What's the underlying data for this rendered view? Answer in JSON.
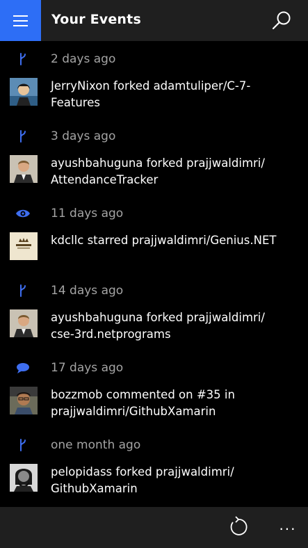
{
  "header": {
    "title": "Your Events",
    "menu_icon": "hamburger-menu-icon",
    "search_icon": "search-icon",
    "accent": "#2d6ef6"
  },
  "events": [
    {
      "type": "fork",
      "icon": "fork-icon",
      "time": "2 days ago",
      "user": "JerryNixon",
      "description": "JerryNixon forked adamtuliper/C-7-Features",
      "line1": "JerryNixon forked adamtuliper/C-7-",
      "line2": "Features"
    },
    {
      "type": "fork",
      "icon": "fork-icon",
      "time": "3 days ago",
      "user": "ayushbahuguna",
      "description": "ayushbahuguna forked prajjwaldimri/AttendanceTracker",
      "line1": "ayushbahuguna forked prajjwaldimri/",
      "line2": "AttendanceTracker"
    },
    {
      "type": "star",
      "icon": "eye-icon",
      "time": "11 days ago",
      "user": "kdcllc",
      "description": "kdcllc starred prajjwaldimri/Genius.NET",
      "line1": "kdcllc starred prajjwaldimri/Genius.NET",
      "line2": ""
    },
    {
      "type": "fork",
      "icon": "fork-icon",
      "time": "14 days ago",
      "user": "ayushbahuguna",
      "description": "ayushbahuguna forked prajjwaldimri/cse-3rd.netprograms",
      "line1": "ayushbahuguna forked prajjwaldimri/",
      "line2": "cse-3rd.netprograms"
    },
    {
      "type": "comment",
      "icon": "comment-icon",
      "time": "17 days ago",
      "user": "bozzmob",
      "description": "bozzmob commented on #35 in prajjwaldimri/GithubXamarin",
      "line1": "bozzmob commented on #35 in",
      "line2": "prajjwaldimri/GithubXamarin"
    },
    {
      "type": "fork",
      "icon": "fork-icon",
      "time": "one month ago",
      "user": "pelopidass",
      "description": "pelopidass forked prajjwaldimri/GithubXamarin",
      "line1": "pelopidass forked prajjwaldimri/",
      "line2": "GithubXamarin"
    }
  ],
  "app_bar": {
    "refresh_icon": "refresh-icon",
    "more_label": "..."
  }
}
